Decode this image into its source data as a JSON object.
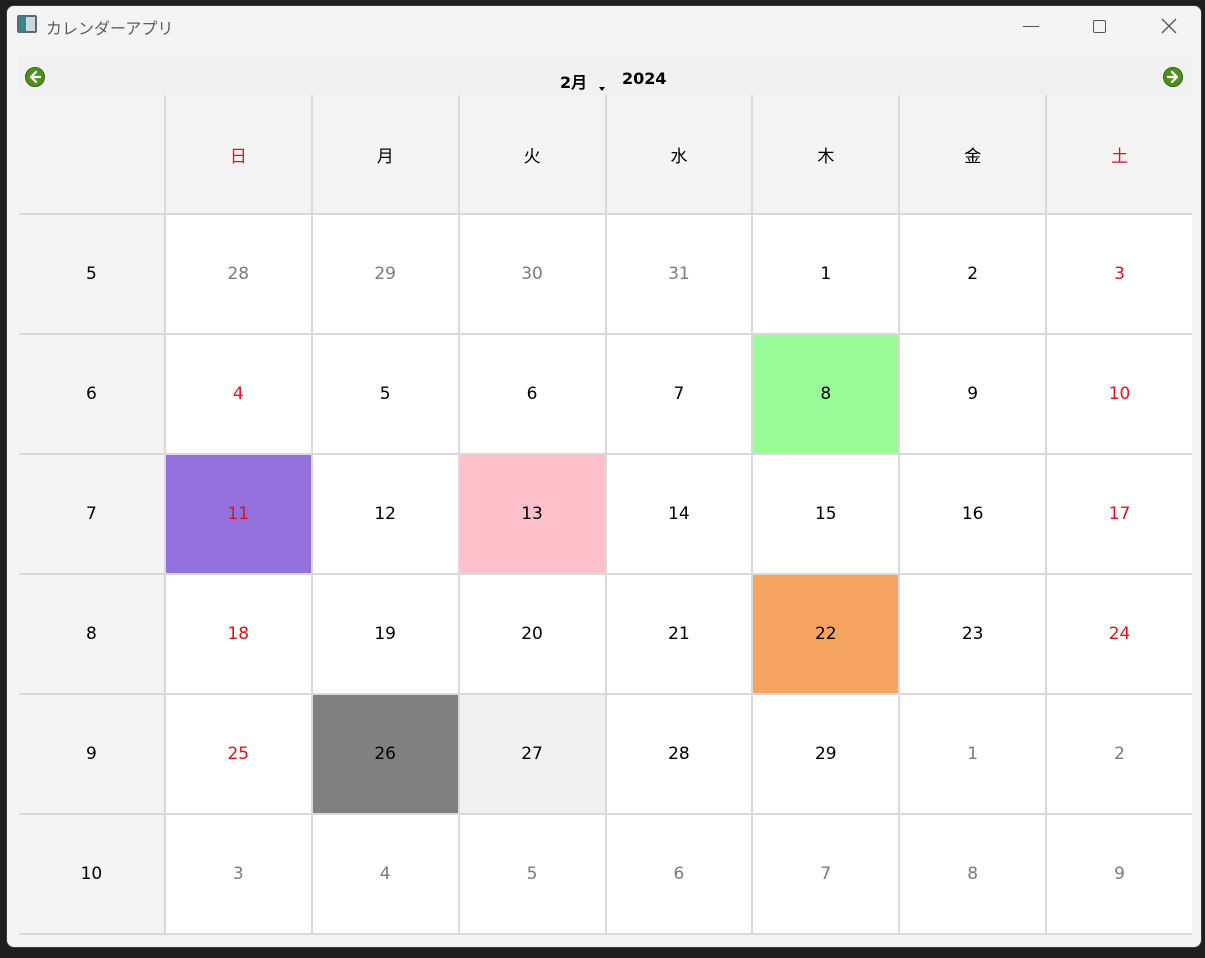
{
  "window": {
    "title": "カレンダーアプリ",
    "controls": {
      "minimize": "minimize-icon",
      "maximize": "maximize-icon",
      "close": "close-icon"
    }
  },
  "nav": {
    "prev_icon": "arrow-left-icon",
    "next_icon": "arrow-right-icon",
    "month": "2月",
    "year": "2024"
  },
  "colors": {
    "weekend_red": "#e2111c",
    "other_month_gray": "#7a7a7a",
    "highlight_green": "#98fb98",
    "highlight_purple": "#9370db",
    "highlight_pink": "#ffc0cb",
    "highlight_orange": "#f4a460",
    "highlight_gray": "#808080",
    "today_bg": "#f0f0f0",
    "nav_arrow": "#4e8f1f"
  },
  "calendar": {
    "weekdays": [
      "日",
      "月",
      "火",
      "水",
      "木",
      "金",
      "土"
    ],
    "weeks": [
      {
        "week": "5",
        "days": [
          "28",
          "29",
          "30",
          "31",
          "1",
          "2",
          "3"
        ]
      },
      {
        "week": "6",
        "days": [
          "4",
          "5",
          "6",
          "7",
          "8",
          "9",
          "10"
        ]
      },
      {
        "week": "7",
        "days": [
          "11",
          "12",
          "13",
          "14",
          "15",
          "16",
          "17"
        ]
      },
      {
        "week": "8",
        "days": [
          "18",
          "19",
          "20",
          "21",
          "22",
          "23",
          "24"
        ]
      },
      {
        "week": "9",
        "days": [
          "25",
          "26",
          "27",
          "28",
          "29",
          "1",
          "2"
        ]
      },
      {
        "week": "10",
        "days": [
          "3",
          "4",
          "5",
          "6",
          "7",
          "8",
          "9"
        ]
      }
    ]
  }
}
